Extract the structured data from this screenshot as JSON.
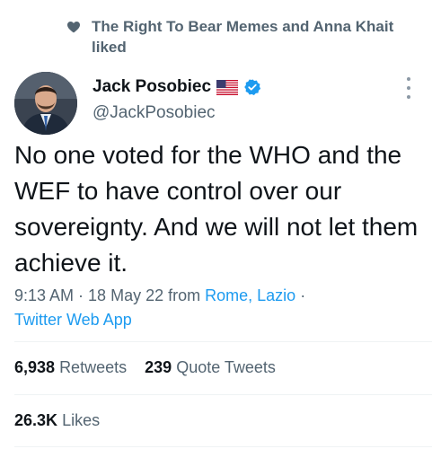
{
  "social_context": {
    "text": "The Right To Bear Memes and Anna Khait liked",
    "icon": "heart-icon"
  },
  "author": {
    "display_name": "Jack Posobiec",
    "handle": "@JackPosobiec",
    "flag_icon": "us-flag-icon",
    "verified_icon": "verified-badge-icon"
  },
  "tweet": {
    "text": "No one voted for the WHO and the WEF to have control over our sovereignty. And we will not let them achieve it.",
    "time": "9:13 AM",
    "date": "18 May 22",
    "location_prefix": "from",
    "location": "Rome, Lazio",
    "source": "Twitter Web App"
  },
  "stats": {
    "retweets_count": "6,938",
    "retweets_label": "Retweets",
    "quotes_count": "239",
    "quotes_label": "Quote Tweets",
    "likes_count": "26.3K",
    "likes_label": "Likes"
  },
  "colors": {
    "link": "#1d9bf0",
    "secondary_text": "#536471",
    "primary_text": "#0f1419"
  }
}
